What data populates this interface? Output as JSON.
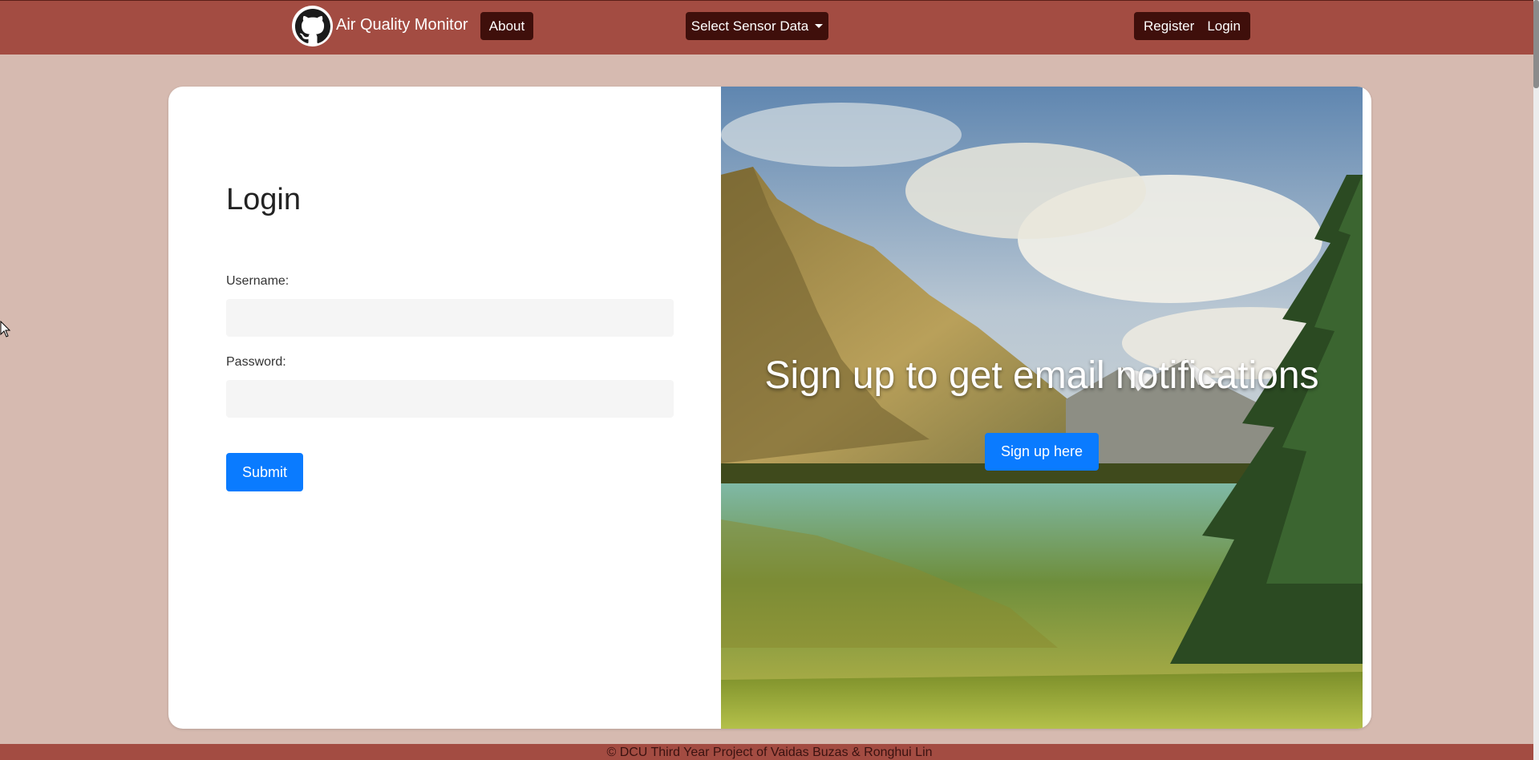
{
  "navbar": {
    "brand_title": "Air Quality Monitor",
    "logo_icon": "github-octocat-icon",
    "about_label": "About",
    "sensor_dropdown_label": "Select Sensor Data",
    "register_label": "Register",
    "login_label": "Login"
  },
  "login_form": {
    "heading": "Login",
    "username_label": "Username:",
    "username_value": "",
    "password_label": "Password:",
    "password_value": "",
    "submit_label": "Submit"
  },
  "promo": {
    "headline": "Sign up to get email notifications",
    "signup_label": "Sign up here"
  },
  "footer": {
    "text": "© DCU Third Year Project of Vaidas Buzas & Ronghui Lin"
  },
  "colors": {
    "navbar": "#a34c42",
    "page_background": "#d6bab0",
    "nav_button": "#3f0f0b",
    "primary_button": "#0a7bff"
  }
}
